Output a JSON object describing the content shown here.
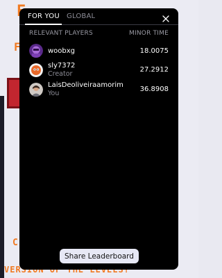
{
  "tabs": [
    {
      "label": "FOR YOU",
      "active": true
    },
    {
      "label": "GLOBAL",
      "active": false
    }
  ],
  "columns": {
    "players": "RELEVANT PLAYERS",
    "time": "MINOR TIME"
  },
  "players": [
    {
      "name": "woobxg",
      "subtitle": "",
      "time": "18.0075",
      "avatar_icon": "purple-character-avatar-icon"
    },
    {
      "name": "sly7372",
      "subtitle": "Creator",
      "time": "27.2912",
      "avatar_icon": "orange-character-avatar-icon"
    },
    {
      "name": "LaisDeoliveiraamorim",
      "subtitle": "You",
      "time": "36.8908",
      "avatar_icon": "person-photo-avatar-icon"
    }
  ],
  "share_button": "Share Leaderboard",
  "colors": {
    "modal_bg": "#000000",
    "button_bg": "#e7e8f5",
    "muted_text": "#8e8e98",
    "background_accent": "#f07a22"
  }
}
